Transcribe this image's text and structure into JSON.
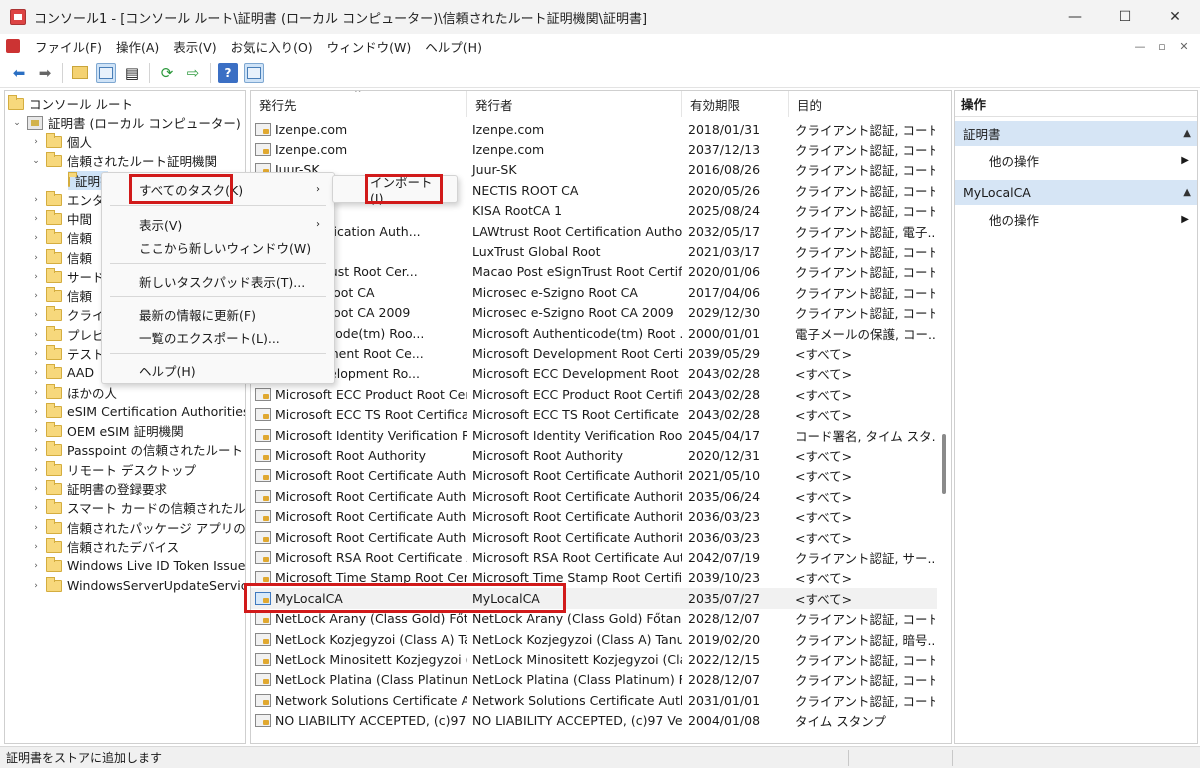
{
  "window": {
    "title": "コンソール1 - [コンソール ルート\\証明書 (ローカル コンピューター)\\信頼されたルート証明機関\\証明書]",
    "min": "—",
    "max": "☐",
    "close": "✕"
  },
  "menu": [
    "ファイル(F)",
    "操作(A)",
    "表示(V)",
    "お気に入り(O)",
    "ウィンドウ(W)",
    "ヘルプ(H)"
  ],
  "mdi": {
    "min": "—",
    "restore": "▫",
    "close": "✕"
  },
  "toolbar": {
    "icons": [
      "back-arrow-icon",
      "forward-arrow-icon",
      "up-folder-icon",
      "show-hide-tree-icon",
      "properties-icon",
      "refresh-icon",
      "export-list-icon",
      "help-icon",
      "show-hide-action-pane-icon"
    ]
  },
  "tree": {
    "root": "コンソール ルート",
    "certs": "証明書 (ローカル コンピューター)",
    "personal": "個人",
    "trusted_root": "信頼されたルート証明機関",
    "certificates": "証明書",
    "items": [
      "エンタ",
      "中間",
      "信頼",
      "信頼",
      "サード",
      "信頼",
      "クライ",
      "プレビ",
      "テスト",
      "AAD",
      "ほかの人",
      "eSIM Certification Authorities",
      "OEM eSIM 証明機関",
      "Passpoint の信頼されたルート",
      "リモート デスクトップ",
      "証明書の登録要求",
      "スマート カードの信頼されたルート",
      "信頼されたパッケージ アプリのインストール",
      "信頼されたデバイス",
      "Windows Live ID Token Issuer",
      "WindowsServerUpdateServices"
    ]
  },
  "list": {
    "headers": [
      "発行先",
      "発行者",
      "有効期限",
      "目的"
    ],
    "sort_arrow": "^",
    "rows": [
      [
        "Izenpe.com",
        "Izenpe.com",
        "2018/01/31",
        "クライアント認証, コード..."
      ],
      [
        "Izenpe.com",
        "Izenpe.com",
        "2037/12/13",
        "クライアント認証, コード..."
      ],
      [
        "Juur-SK",
        "Juur-SK",
        "2016/08/26",
        "クライアント認証, コード..."
      ],
      [
        "",
        "NECTIS ROOT CA",
        "2020/05/26",
        "クライアント認証, コード..."
      ],
      [
        "A 1",
        "KISA RootCA 1",
        "2025/08/24",
        "クライアント認証, コード..."
      ],
      [
        "oot Certification Auth...",
        "LAWtrust Root Certification Authori...",
        "2032/05/17",
        "クライアント認証, 電子..."
      ],
      [
        "obal Root",
        "LuxTrust Global Root",
        "2021/03/17",
        "クライアント認証, コード..."
      ],
      [
        "t eSignTrust Root Cer...",
        "Macao Post eSignTrust Root Certifi...",
        "2020/01/06",
        "クライアント認証, コード..."
      ],
      [
        "-Szigno Root CA",
        "Microsec e-Szigno Root CA",
        "2017/04/06",
        "クライアント認証, コード..."
      ],
      [
        "-Szigno Root CA 2009",
        "Microsec e-Szigno Root CA 2009",
        "2029/12/30",
        "クライアント認証, コード..."
      ],
      [
        "Authenticode(tm) Roo...",
        "Microsoft Authenticode(tm) Root ...",
        "2000/01/01",
        "電子メールの保護, コー..."
      ],
      [
        "Development Root Ce...",
        "Microsoft Development Root Certi...",
        "2039/05/29",
        "<すべて>"
      ],
      [
        "ECC Development Ro...",
        "Microsoft ECC Development Root ...",
        "2043/02/28",
        "<すべて>"
      ],
      [
        "Microsoft ECC Product Root Cert...",
        "Microsoft ECC Product Root Certifi...",
        "2043/02/28",
        "<すべて>"
      ],
      [
        "Microsoft ECC TS Root Certificat...",
        "Microsoft ECC TS Root Certificate A...",
        "2043/02/28",
        "<すべて>"
      ],
      [
        "Microsoft Identity Verification R...",
        "Microsoft Identity Verification Roo...",
        "2045/04/17",
        "コード署名, タイム スタ..."
      ],
      [
        "Microsoft Root Authority",
        "Microsoft Root Authority",
        "2020/12/31",
        "<すべて>"
      ],
      [
        "Microsoft Root Certificate Autho...",
        "Microsoft Root Certificate Authority",
        "2021/05/10",
        "<すべて>"
      ],
      [
        "Microsoft Root Certificate Autho...",
        "Microsoft Root Certificate Authorit...",
        "2035/06/24",
        "<すべて>"
      ],
      [
        "Microsoft Root Certificate Autho...",
        "Microsoft Root Certificate Authorit...",
        "2036/03/23",
        "<すべて>"
      ],
      [
        "Microsoft Root Certificate Autho...",
        "Microsoft Root Certificate Authorit...",
        "2036/03/23",
        "<すべて>"
      ],
      [
        "Microsoft RSA Root Certificate A...",
        "Microsoft RSA Root Certificate Aut...",
        "2042/07/19",
        "クライアント認証, サー..."
      ],
      [
        "Microsoft Time Stamp Root Cert...",
        "Microsoft Time Stamp Root Certific...",
        "2039/10/23",
        "<すべて>"
      ],
      [
        "MyLocalCA",
        "MyLocalCA",
        "2035/07/27",
        "<すべて>"
      ],
      [
        "NetLock Arany (Class Gold) Főta...",
        "NetLock Arany (Class Gold) Főtanú...",
        "2028/12/07",
        "クライアント認証, コード..."
      ],
      [
        "NetLock Kozjegyzoi (Class A) Tan...",
        "NetLock Kozjegyzoi (Class A) Tanus...",
        "2019/02/20",
        "クライアント認証, 暗号..."
      ],
      [
        "NetLock Minositett Kozjegyzoi (...",
        "NetLock Minositett Kozjegyzoi (Cla...",
        "2022/12/15",
        "クライアント認証, コード..."
      ],
      [
        "NetLock Platina (Class Platinum) ...",
        "NetLock Platina (Class Platinum) Fő...",
        "2028/12/07",
        "クライアント認証, コード..."
      ],
      [
        "Network Solutions Certificate Au...",
        "Network Solutions Certificate Auth...",
        "2031/01/01",
        "クライアント認証, コード..."
      ],
      [
        "NO LIABILITY ACCEPTED, (c)97 Ve...",
        "NO LIABILITY ACCEPTED, (c)97 VeriS...",
        "2004/01/08",
        "タイム スタンプ"
      ]
    ]
  },
  "actions": {
    "title": "操作",
    "sections": [
      {
        "label": "証明書",
        "item": "他の操作"
      },
      {
        "label": "MyLocalCA",
        "item": "他の操作"
      }
    ]
  },
  "context_menu": {
    "all_tasks": "すべてのタスク(K)",
    "view": "表示(V)",
    "new_window": "ここから新しいウィンドウ(W)",
    "new_taskpad": "新しいタスクパッド表示(T)...",
    "refresh": "最新の情報に更新(F)",
    "export_list": "一覧のエクスポート(L)...",
    "help": "ヘルプ(H)"
  },
  "submenu": {
    "import": "インポート(I)..."
  },
  "status": "証明書をストアに追加します",
  "colors": {
    "highlight_box": "#d11a1a",
    "selection": "#cfe3f7",
    "action_section": "#d6e5f5"
  }
}
